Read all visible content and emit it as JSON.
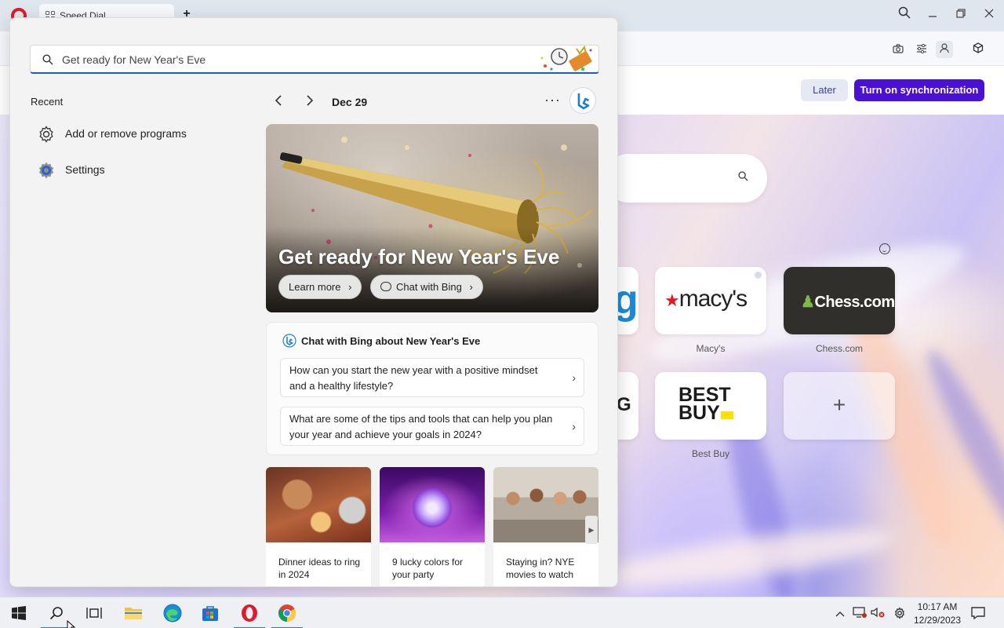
{
  "browser": {
    "tab_title": "Speed Dial",
    "sync_bar": {
      "later_label": "Later",
      "sync_label": "Turn on synchronization"
    },
    "speed_dial": {
      "tiles": [
        {
          "name": "Macy's",
          "logo_text": "macy's"
        },
        {
          "name": "Chess.com",
          "logo_text": "Chess.com"
        },
        {
          "name": "Best Buy",
          "logo_text_line1": "BEST",
          "logo_text_line2": "BUY"
        }
      ],
      "add_tile_glyph": "+",
      "partial_tiles": [
        {
          "glyph": "g"
        },
        {
          "glyph": "G"
        }
      ]
    }
  },
  "search_flyout": {
    "search": {
      "placeholder": "Get ready for New Year's Eve"
    },
    "recent": {
      "title": "Recent",
      "items": [
        {
          "label": "Add or remove programs",
          "icon": "gear-icon"
        },
        {
          "label": "Settings",
          "icon": "settings-gear-icon"
        }
      ]
    },
    "date": "Dec 29",
    "more_glyph": "···",
    "hero": {
      "title": "Get ready for New Year's Eve",
      "learn_more": "Learn more",
      "chat_with_bing": "Chat with Bing"
    },
    "chat_card": {
      "heading": "Chat with Bing about New Year's Eve",
      "questions": [
        "How can you start the new year with a positive mindset and a healthy lifestyle?",
        "What are some of the tips and tools that can help you plan your year and achieve your goals in 2024?"
      ]
    },
    "cards": [
      {
        "caption": "Dinner ideas to ring in 2024"
      },
      {
        "caption": "9 lucky colors for your party"
      },
      {
        "caption": "Staying in? NYE movies to watch"
      }
    ]
  },
  "taskbar": {
    "apps": [
      "start",
      "search",
      "task-view",
      "file-explorer",
      "edge",
      "store",
      "opera",
      "chrome"
    ],
    "clock": {
      "time": "10:17 AM",
      "date": "12/29/2023"
    }
  },
  "colors": {
    "accent": "#4a10d6",
    "opera_red": "#e0192c",
    "search_underline": "#1a5fb4"
  }
}
